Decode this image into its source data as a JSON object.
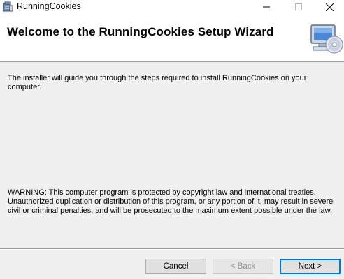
{
  "window": {
    "title": "RunningCookies",
    "icon": "installer-icon",
    "controls": {
      "minimize": "minimize-icon",
      "maximize": "maximize-icon",
      "close": "close-icon"
    }
  },
  "header": {
    "title": "Welcome to the RunningCookies Setup Wizard",
    "graphic": "computer-cd-icon"
  },
  "body": {
    "intro": "The installer will guide you through the steps required to install RunningCookies on your computer.",
    "warning": "WARNING: This computer program is protected by copyright law and international treaties. Unauthorized duplication or distribution of this program, or any portion of it, may result in severe civil or criminal penalties, and will be prosecuted to the maximum extent possible under the law."
  },
  "buttons": {
    "cancel": "Cancel",
    "back": "< Back",
    "next": "Next >"
  },
  "colors": {
    "header_bg": "#ffffff",
    "dialog_bg": "#f0f0f0",
    "default_button_border": "#0078d7",
    "disabled_text": "#8d8d8d"
  }
}
